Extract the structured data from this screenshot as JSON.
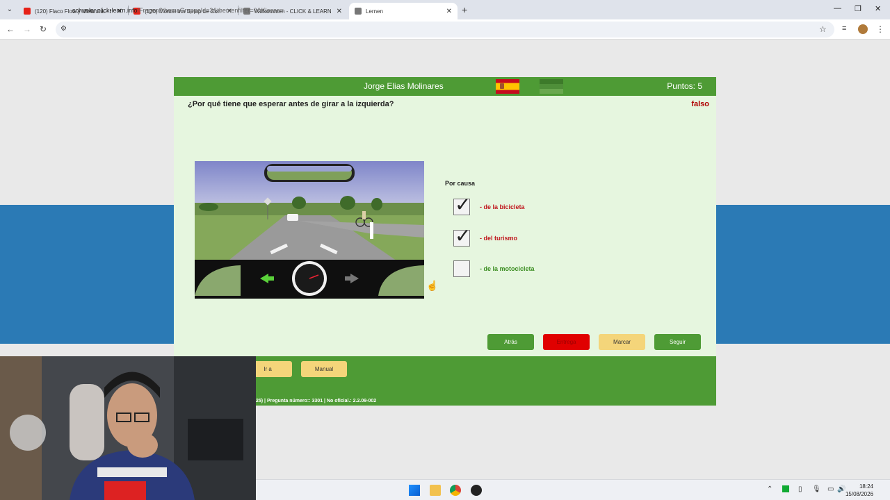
{
  "browser": {
    "tabs": [
      {
        "title": "(120) Flaco Flow y Melanina - El",
        "icon": "youtube-icon"
      },
      {
        "title": "(120) Montei um Setup de Con",
        "icon": "youtube-icon"
      },
      {
        "title": "Willkommen - CLICK & LEARN",
        "icon": "site-icon"
      },
      {
        "title": "Lernen",
        "icon": "site-icon"
      }
    ],
    "new_tab": "+",
    "url_domain": "schueler.click-learn.info",
    "url_path": "/Fragen?themaGruppeId=3&themenfilter=0&Klasse="
  },
  "quiz": {
    "user_name": "Jorge Elias Molinares",
    "points": "Puntos: 5",
    "question": "¿Por qué tiene que esperar antes de girar a la izquierda?",
    "status": "falso",
    "answers_title": "Por causa",
    "answers": [
      {
        "label": "- de la bicicleta",
        "checked": true,
        "color": "#c0161d"
      },
      {
        "label": "- del turismo",
        "checked": true,
        "color": "#c0161d"
      },
      {
        "label": "- de la motocicleta",
        "checked": false,
        "color": "#3a8d20"
      }
    ],
    "buttons": {
      "back": "Atrás",
      "submit": "Entrega",
      "mark": "Marcar",
      "next": "Seguir"
    }
  },
  "footer": {
    "goto": "Ir a",
    "manual": "Manual",
    "info": "25) | Pregunta número:: 3301 | No oficial.: 2.2.09-002"
  },
  "taskbar": {
    "time": "18:24",
    "date": "15/08/2026"
  },
  "colors": {
    "header_green": "#4e9b35",
    "card_bg": "#e6f6df",
    "wrong_red": "#c0161d",
    "correct_green": "#3a8d20"
  }
}
